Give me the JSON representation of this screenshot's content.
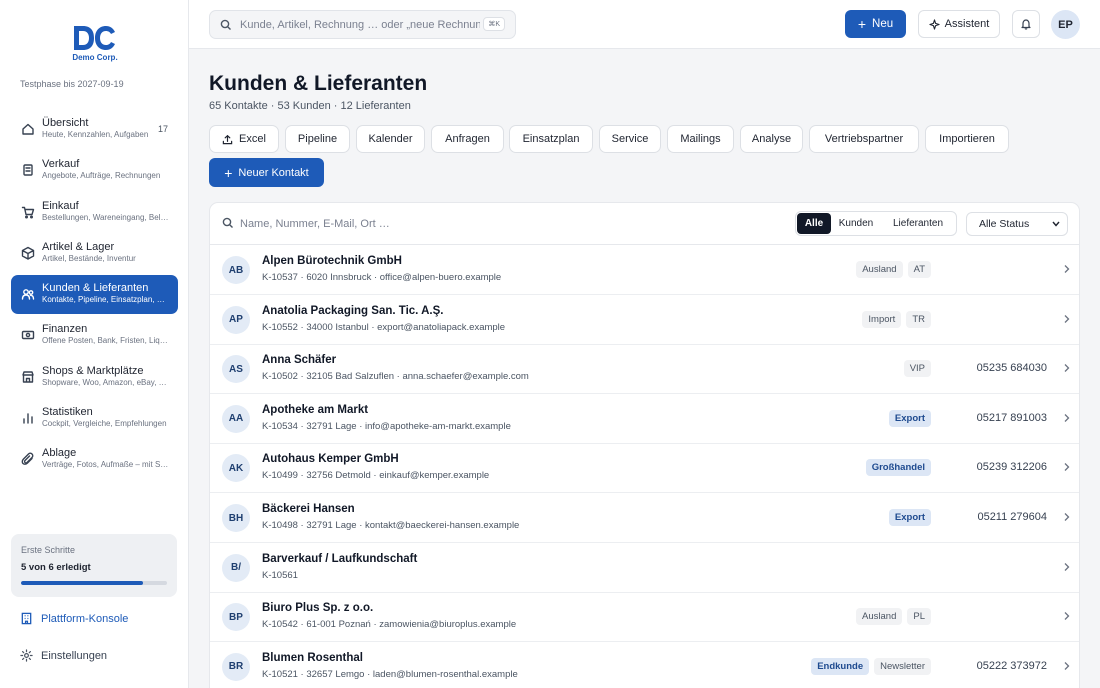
{
  "brand": {
    "logo_mark": "DC",
    "name": "Demo Corp.",
    "trial": "Testphase bis 2027-09-19",
    "color": "#1e5bb8"
  },
  "sidebar": {
    "items": [
      {
        "label": "Übersicht",
        "sub": "Heute, Kennzahlen, Aufgaben",
        "count": "17",
        "icon": "home-icon"
      },
      {
        "label": "Verkauf",
        "sub": "Angebote, Aufträge, Rechnungen",
        "icon": "receipt-icon"
      },
      {
        "label": "Einkauf",
        "sub": "Bestellungen, Wareneingang, Belege",
        "icon": "cart-icon"
      },
      {
        "label": "Artikel & Lager",
        "sub": "Artikel, Bestände, Inventur",
        "icon": "box-icon"
      },
      {
        "label": "Kunden & Lieferanten",
        "sub": "Kontakte, Pipeline, Einsatzplan, Service",
        "icon": "users-icon",
        "active": true
      },
      {
        "label": "Finanzen",
        "sub": "Offene Posten, Bank, Fristen, Liquidität",
        "icon": "money-icon"
      },
      {
        "label": "Shops & Marktplätze",
        "sub": "Shopware, Woo, Amazon, eBay, Kaufland",
        "icon": "shop-icon"
      },
      {
        "label": "Statistiken",
        "sub": "Cockpit, Vergleiche, Empfehlungen",
        "icon": "chart-icon"
      },
      {
        "label": "Ablage",
        "sub": "Verträge, Fotos, Aufmaße – mit Suche",
        "icon": "paperclip-icon"
      }
    ],
    "progress": {
      "title": "Erste Schritte",
      "status": "5 von 6 erledigt",
      "done": 5,
      "total": 6
    },
    "console": "Plattform-Konsole",
    "settings": "Einstellungen"
  },
  "topbar": {
    "search_placeholder": "Kunde, Artikel, Rechnung … oder „neue Rechnung“",
    "shortcut": "⌘K",
    "new": "Neu",
    "assistant": "Assistent",
    "user_initials": "EP"
  },
  "page": {
    "title": "Kunden & Lieferanten",
    "subtitle": "65 Kontakte · 53 Kunden · 12 Lieferanten",
    "tabs": [
      "Excel",
      "Pipeline",
      "Kalender",
      "Anfragen",
      "Einsatzplan",
      "Service",
      "Mailings",
      "Analyse",
      "Vertriebspartner",
      "Importieren"
    ],
    "new_contact": "Neuer Kontakt"
  },
  "filters": {
    "search_placeholder": "Name, Nummer, E-Mail, Ort …",
    "segments": [
      "Alle",
      "Kunden",
      "Lieferanten"
    ],
    "active_segment": "Alle",
    "status": "Alle Status"
  },
  "contacts": [
    {
      "initials": "AB",
      "name": "Alpen Bürotechnik GmbH",
      "detail": "K-10537 · 6020 Innsbruck · office@alpen-buero.example",
      "tags": [
        {
          "t": "Ausland",
          "hl": false
        },
        {
          "t": "AT",
          "hl": false
        }
      ],
      "phone": ""
    },
    {
      "initials": "AP",
      "name": "Anatolia Packaging San. Tic. A.Ş.",
      "detail": "K-10552 · 34000 Istanbul · export@anatoliapack.example",
      "tags": [
        {
          "t": "Import",
          "hl": false
        },
        {
          "t": "TR",
          "hl": false
        }
      ],
      "phone": ""
    },
    {
      "initials": "AS",
      "name": "Anna Schäfer",
      "detail": "K-10502 · 32105 Bad Salzuflen · anna.schaefer@example.com",
      "tags": [
        {
          "t": "VIP",
          "hl": false
        }
      ],
      "phone": "05235 684030"
    },
    {
      "initials": "AA",
      "name": "Apotheke am Markt",
      "detail": "K-10534 · 32791 Lage · info@apotheke-am-markt.example",
      "tags": [
        {
          "t": "Export",
          "hl": true
        }
      ],
      "phone": "05217 891003"
    },
    {
      "initials": "AK",
      "name": "Autohaus Kemper GmbH",
      "detail": "K-10499 · 32756 Detmold · einkauf@kemper.example",
      "tags": [
        {
          "t": "Großhandel",
          "hl": true
        }
      ],
      "phone": "05239 312206"
    },
    {
      "initials": "BH",
      "name": "Bäckerei Hansen",
      "detail": "K-10498 · 32791 Lage · kontakt@baeckerei-hansen.example",
      "tags": [
        {
          "t": "Export",
          "hl": true
        }
      ],
      "phone": "05211 279604"
    },
    {
      "initials": "B/",
      "name": "Barverkauf / Laufkundschaft",
      "detail": "K-10561",
      "tags": [],
      "phone": ""
    },
    {
      "initials": "BP",
      "name": "Biuro Plus Sp. z o.o.",
      "detail": "K-10542 · 61-001 Poznań · zamowienia@biuroplus.example",
      "tags": [
        {
          "t": "Ausland",
          "hl": false
        },
        {
          "t": "PL",
          "hl": false
        }
      ],
      "phone": ""
    },
    {
      "initials": "BR",
      "name": "Blumen Rosenthal",
      "detail": "K-10521 · 32657 Lemgo · laden@blumen-rosenthal.example",
      "tags": [
        {
          "t": "Endkunde",
          "hl": true
        },
        {
          "t": "Newsletter",
          "hl": false
        }
      ],
      "phone": "05222 373972"
    }
  ]
}
